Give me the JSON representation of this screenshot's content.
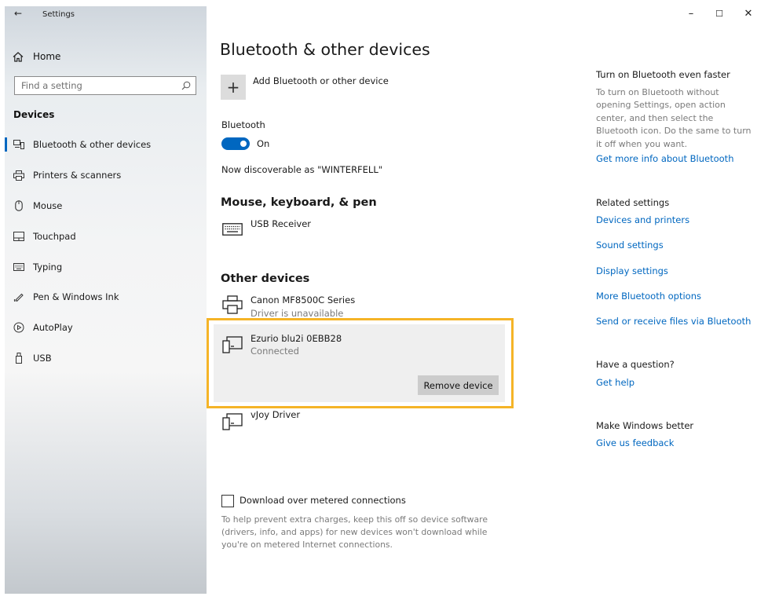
{
  "window": {
    "title": "Settings",
    "back_glyph": "←",
    "minimize_glyph": "–",
    "maximize_glyph": "☐",
    "close_glyph": "✕"
  },
  "sidebar": {
    "home_label": "Home",
    "search_placeholder": "Find a setting",
    "section_title": "Devices",
    "items": [
      {
        "label": "Bluetooth & other devices",
        "icon": "bluetooth-devices-icon",
        "active": true
      },
      {
        "label": "Printers & scanners",
        "icon": "printer-icon"
      },
      {
        "label": "Mouse",
        "icon": "mouse-icon"
      },
      {
        "label": "Touchpad",
        "icon": "touchpad-icon"
      },
      {
        "label": "Typing",
        "icon": "keyboard-icon"
      },
      {
        "label": "Pen & Windows Ink",
        "icon": "pen-icon"
      },
      {
        "label": "AutoPlay",
        "icon": "autoplay-icon"
      },
      {
        "label": "USB",
        "icon": "usb-icon"
      }
    ]
  },
  "main": {
    "title": "Bluetooth & other devices",
    "add_device_label": "Add Bluetooth or other device",
    "add_glyph": "+",
    "bluetooth_label": "Bluetooth",
    "bluetooth_state": "On",
    "discoverable_text": "Now discoverable as \"WINTERFELL\"",
    "mkp_heading": "Mouse, keyboard, & pen",
    "mkp_devices": [
      {
        "name": "USB Receiver",
        "icon": "keyboard-icon"
      }
    ],
    "other_heading": "Other devices",
    "other_devices": [
      {
        "name": "Canon MF8500C Series",
        "status": "Driver is unavailable",
        "icon": "printer-icon"
      },
      {
        "name": "Ezurio blu2i 0EBB28",
        "status": "Connected",
        "icon": "device-icon",
        "selected": true
      },
      {
        "name": "vJoy Driver",
        "icon": "device-icon"
      }
    ],
    "remove_button_label": "Remove device",
    "metered_label": "Download over metered connections",
    "metered_help": "To help prevent extra charges, keep this off so device software (drivers, info, and apps) for new devices won't download while you're on metered Internet connections."
  },
  "right": {
    "faster_heading": "Turn on Bluetooth even faster",
    "faster_text": "To turn on Bluetooth without opening Settings, open action center, and then select the Bluetooth icon. Do the same to turn it off when you want.",
    "faster_link": "Get more info about Bluetooth",
    "related_heading": "Related settings",
    "related_links": [
      "Devices and printers",
      "Sound settings",
      "Display settings",
      "More Bluetooth options",
      "Send or receive files via Bluetooth"
    ],
    "question_heading": "Have a question?",
    "question_link": "Get help",
    "better_heading": "Make Windows better",
    "better_link": "Give us feedback"
  },
  "colors": {
    "accent": "#0067c0",
    "highlight_border": "#f5b427"
  }
}
